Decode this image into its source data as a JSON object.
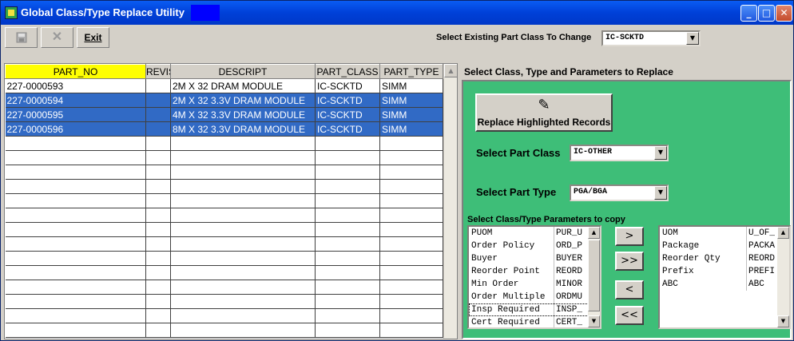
{
  "window": {
    "title": "Global Class/Type Replace Utility",
    "controls": {
      "minimize": "_",
      "maximize": "□",
      "close": "✕"
    }
  },
  "toolbar": {
    "save_icon": "floppy-disk-icon",
    "cancel_label": "✕",
    "exit_label": "Exit"
  },
  "class_selector": {
    "label": "Select Existing Part Class To Change",
    "value": "IC-SCKTD"
  },
  "grid": {
    "columns": [
      "PART_NO",
      "REVIS",
      "DESCRIPT",
      "PART_CLASS",
      "PART_TYPE"
    ],
    "rows": [
      {
        "part_no": "227-0000593",
        "revis": "",
        "descript": "2M X 32 DRAM MODULE",
        "part_class": "IC-SCKTD",
        "part_type": "SIMM",
        "selected": false
      },
      {
        "part_no": "227-0000594",
        "revis": "",
        "descript": "2M X 32 3.3V DRAM MODULE",
        "part_class": "IC-SCKTD",
        "part_type": "SIMM",
        "selected": true
      },
      {
        "part_no": "227-0000595",
        "revis": "",
        "descript": "4M X 32 3.3V DRAM MODULE",
        "part_class": "IC-SCKTD",
        "part_type": "SIMM",
        "selected": true
      },
      {
        "part_no": "227-0000596",
        "revis": "",
        "descript": "8M X 32 3.3V DRAM MODULE",
        "part_class": "IC-SCKTD",
        "part_type": "SIMM",
        "selected": true
      }
    ],
    "empty_row_count": 14
  },
  "replace_panel": {
    "title": "Select Class, Type and Parameters to Replace",
    "replace_button_label": "Replace Highlighted Records",
    "part_class_label": "Select Part Class",
    "part_class_value": "IC-OTHER",
    "part_type_label": "Select Part Type",
    "part_type_value": "PGA/BGA",
    "params_label": "Select Class/Type Parameters to copy",
    "source_params": [
      {
        "name": "PUOM",
        "field": "PUR_U"
      },
      {
        "name": "Order Policy",
        "field": "ORD_P"
      },
      {
        "name": "Buyer",
        "field": "BUYER"
      },
      {
        "name": "Reorder Point",
        "field": "REORD"
      },
      {
        "name": "Min Order",
        "field": "MINOR"
      },
      {
        "name": "Order Multiple",
        "field": "ORDMU"
      },
      {
        "name": "Insp Required",
        "field": "INSP_"
      },
      {
        "name": "Cert Required",
        "field": "CERT_"
      }
    ],
    "target_params": [
      {
        "name": "UOM",
        "field": "U_OF_"
      },
      {
        "name": "Package",
        "field": "PACKA"
      },
      {
        "name": "Reorder Qty",
        "field": "REORD"
      },
      {
        "name": "Prefix",
        "field": "PREFI"
      },
      {
        "name": "ABC",
        "field": "ABC"
      }
    ],
    "buttons": {
      "move_one": ">",
      "move_all": ">>",
      "remove_one": "<",
      "remove_all": "<<"
    }
  },
  "colors": {
    "title_bar": "#0040d8",
    "highlight": "#316ac5",
    "part_no_header": "#ffff00",
    "panel_green": "#3ebe78"
  }
}
